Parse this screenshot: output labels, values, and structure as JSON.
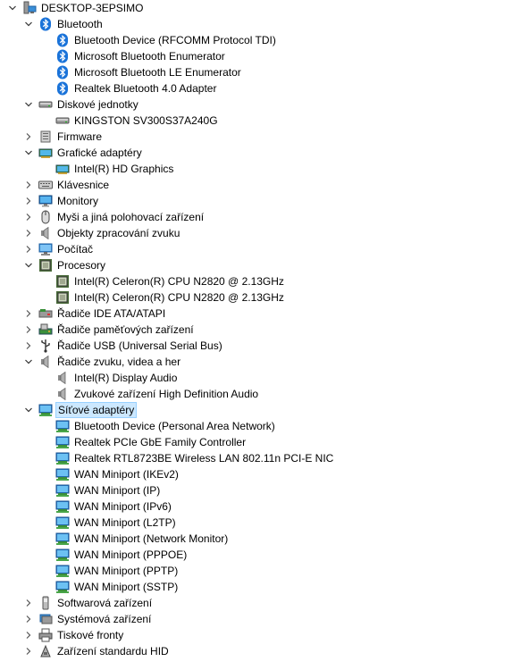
{
  "computer_name": "DESKTOP-3EPSIMO",
  "categories": [
    {
      "label": "Bluetooth",
      "icon": "bluetooth-icon",
      "expanded": true,
      "children": [
        {
          "label": "Bluetooth Device (RFCOMM Protocol TDI)",
          "icon": "bluetooth-icon"
        },
        {
          "label": "Microsoft Bluetooth Enumerator",
          "icon": "bluetooth-icon"
        },
        {
          "label": "Microsoft Bluetooth LE Enumerator",
          "icon": "bluetooth-icon"
        },
        {
          "label": "Realtek Bluetooth 4.0 Adapter",
          "icon": "bluetooth-icon"
        }
      ]
    },
    {
      "label": "Diskové jednotky",
      "icon": "disk-drive-icon",
      "expanded": true,
      "children": [
        {
          "label": "KINGSTON SV300S37A240G",
          "icon": "disk-drive-icon"
        }
      ]
    },
    {
      "label": "Firmware",
      "icon": "firmware-icon",
      "expanded": false,
      "children": []
    },
    {
      "label": "Grafické adaptéry",
      "icon": "display-adapter-icon",
      "expanded": true,
      "children": [
        {
          "label": "Intel(R) HD Graphics",
          "icon": "display-adapter-icon"
        }
      ]
    },
    {
      "label": "Klávesnice",
      "icon": "keyboard-icon",
      "expanded": false,
      "children": []
    },
    {
      "label": "Monitory",
      "icon": "monitor-icon",
      "expanded": false,
      "children": []
    },
    {
      "label": "Myši a jiná polohovací zařízení",
      "icon": "mouse-icon",
      "expanded": false,
      "children": []
    },
    {
      "label": "Objekty zpracování zvuku",
      "icon": "speaker-icon",
      "expanded": false,
      "children": []
    },
    {
      "label": "Počítač",
      "icon": "computer-icon",
      "expanded": false,
      "children": []
    },
    {
      "label": "Procesory",
      "icon": "processor-icon",
      "expanded": true,
      "children": [
        {
          "label": "Intel(R) Celeron(R) CPU  N2820  @ 2.13GHz",
          "icon": "processor-icon"
        },
        {
          "label": "Intel(R) Celeron(R) CPU  N2820  @ 2.13GHz",
          "icon": "processor-icon"
        }
      ]
    },
    {
      "label": "Řadiče IDE ATA/ATAPI",
      "icon": "ide-controller-icon",
      "expanded": false,
      "children": []
    },
    {
      "label": "Řadiče paměťových zařízení",
      "icon": "storage-controller-icon",
      "expanded": false,
      "children": []
    },
    {
      "label": "Řadiče USB (Universal Serial Bus)",
      "icon": "usb-icon",
      "expanded": false,
      "children": []
    },
    {
      "label": "Řadiče zvuku, videa a her",
      "icon": "speaker-icon",
      "expanded": true,
      "children": [
        {
          "label": "Intel(R) Display Audio",
          "icon": "speaker-icon"
        },
        {
          "label": "Zvukové zařízení High Definition Audio",
          "icon": "speaker-icon"
        }
      ]
    },
    {
      "label": "Síťové adaptéry",
      "icon": "network-adapter-icon",
      "expanded": true,
      "selected": true,
      "children": [
        {
          "label": "Bluetooth Device (Personal Area Network)",
          "icon": "network-adapter-icon"
        },
        {
          "label": "Realtek PCIe GbE Family Controller",
          "icon": "network-adapter-icon"
        },
        {
          "label": "Realtek RTL8723BE Wireless LAN 802.11n PCI-E NIC",
          "icon": "network-adapter-icon"
        },
        {
          "label": "WAN Miniport (IKEv2)",
          "icon": "network-adapter-icon"
        },
        {
          "label": "WAN Miniport (IP)",
          "icon": "network-adapter-icon"
        },
        {
          "label": "WAN Miniport (IPv6)",
          "icon": "network-adapter-icon"
        },
        {
          "label": "WAN Miniport (L2TP)",
          "icon": "network-adapter-icon"
        },
        {
          "label": "WAN Miniport (Network Monitor)",
          "icon": "network-adapter-icon"
        },
        {
          "label": "WAN Miniport (PPPOE)",
          "icon": "network-adapter-icon"
        },
        {
          "label": "WAN Miniport (PPTP)",
          "icon": "network-adapter-icon"
        },
        {
          "label": "WAN Miniport (SSTP)",
          "icon": "network-adapter-icon"
        }
      ]
    },
    {
      "label": "Softwarová zařízení",
      "icon": "software-device-icon",
      "expanded": false,
      "children": []
    },
    {
      "label": "Systémová zařízení",
      "icon": "system-device-icon",
      "expanded": false,
      "children": []
    },
    {
      "label": "Tiskové fronty",
      "icon": "printer-icon",
      "expanded": false,
      "children": []
    },
    {
      "label": "Zařízení standardu HID",
      "icon": "hid-icon",
      "expanded": false,
      "children": []
    }
  ]
}
